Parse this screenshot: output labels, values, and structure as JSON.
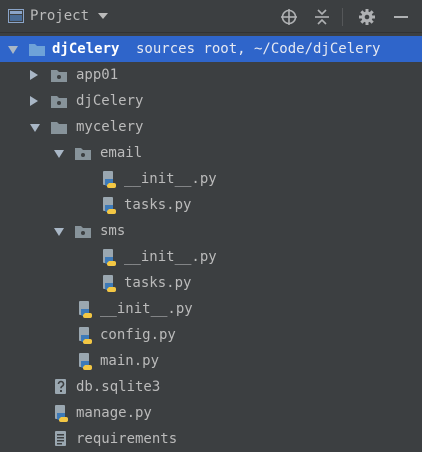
{
  "header": {
    "title": "Project"
  },
  "colors": {
    "selection": "#2f65ca",
    "panel_bg": "#3c3f41",
    "text": "#bbbbbb",
    "folder": "#87939a",
    "python_blue": "#3d7ab8",
    "python_yellow": "#f3c744"
  },
  "tree": [
    {
      "name": "djCelery",
      "suffix": "sources root, ~/Code/djCelery",
      "icon": "source-root-folder-icon",
      "expanded": true,
      "selected": true
    },
    {
      "name": "app01",
      "icon": "package-folder-icon",
      "expanded": false
    },
    {
      "name": "djCelery",
      "icon": "package-folder-icon",
      "expanded": false
    },
    {
      "name": "mycelery",
      "icon": "folder-icon",
      "expanded": true
    },
    {
      "name": "email",
      "icon": "package-folder-icon",
      "expanded": true
    },
    {
      "name": "__init__.py",
      "icon": "python-file-icon"
    },
    {
      "name": "tasks.py",
      "icon": "python-file-icon"
    },
    {
      "name": "sms",
      "icon": "package-folder-icon",
      "expanded": true
    },
    {
      "name": "__init__.py",
      "icon": "python-file-icon"
    },
    {
      "name": "tasks.py",
      "icon": "python-file-icon"
    },
    {
      "name": "__init__.py",
      "icon": "python-file-icon"
    },
    {
      "name": "config.py",
      "icon": "python-file-icon"
    },
    {
      "name": "main.py",
      "icon": "python-file-icon"
    },
    {
      "name": "db.sqlite3",
      "icon": "unknown-file-icon"
    },
    {
      "name": "manage.py",
      "icon": "python-file-icon"
    },
    {
      "name": "requirements",
      "icon": "text-file-icon"
    }
  ]
}
